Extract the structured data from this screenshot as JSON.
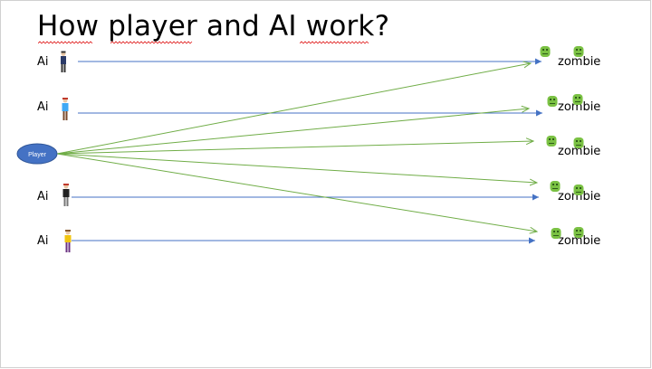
{
  "slide": {
    "title": "How player and AI work?",
    "player_label": "Player",
    "ai_label": "Ai",
    "zombie_label": "zombie"
  },
  "rows": [
    {
      "ai": "Ai",
      "zombie": "zombie"
    },
    {
      "ai": "Ai",
      "zombie": "zombie"
    },
    {
      "ai": null,
      "zombie": "zombie"
    },
    {
      "ai": "Ai",
      "zombie": "zombie"
    },
    {
      "ai": "Ai",
      "zombie": "zombie"
    }
  ],
  "colors": {
    "player_fill": "#4472c4",
    "ai_arrow": "#4472c4",
    "player_arrow": "#70ad47",
    "zombie_green": "#7ac143",
    "spellcheck_underline": "#e02020"
  },
  "icons": [
    "person-icon",
    "zombie-icon"
  ]
}
